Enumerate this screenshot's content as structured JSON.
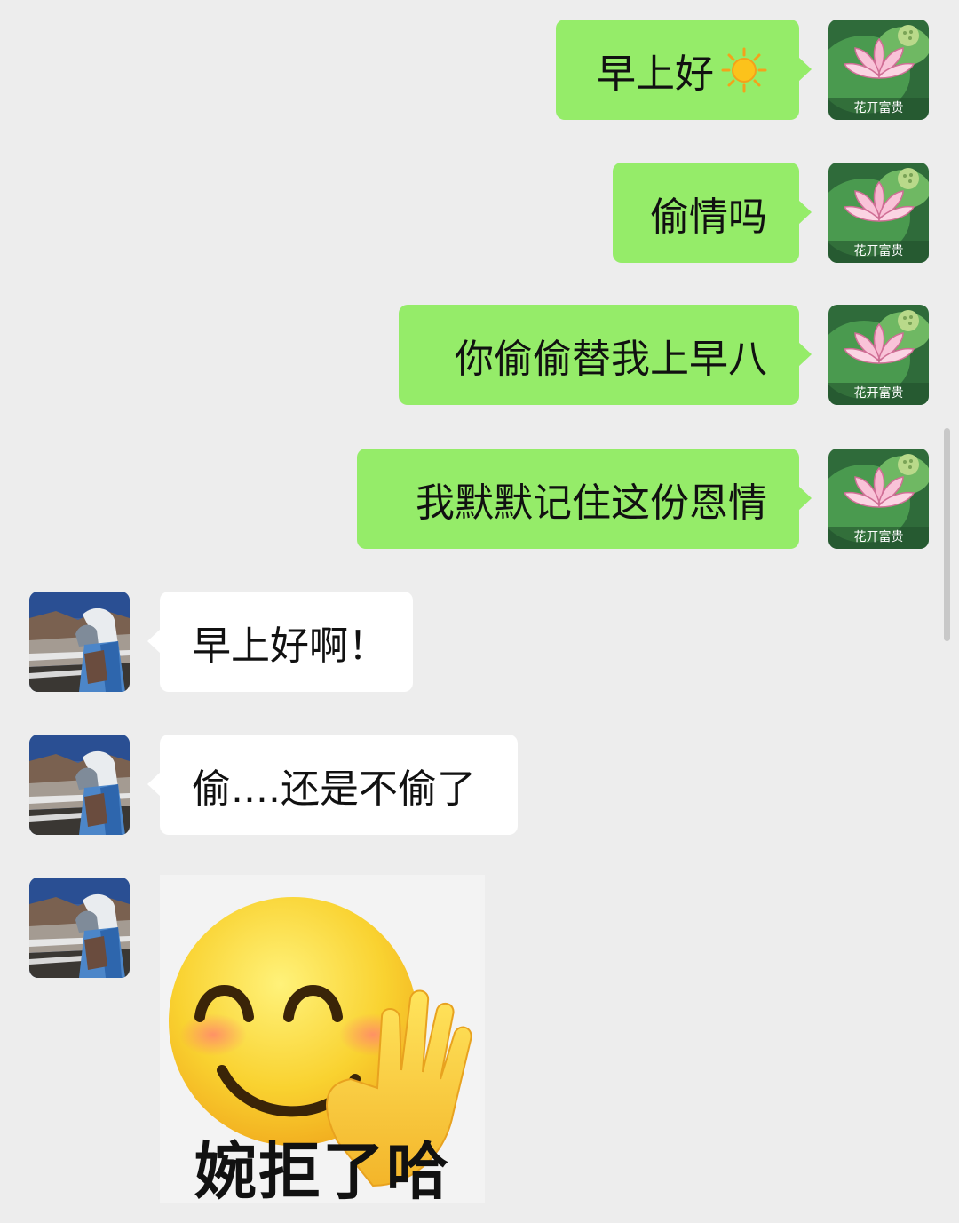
{
  "colors": {
    "background": "#ededed",
    "outgoing_bubble": "#95ec69",
    "incoming_bubble": "#ffffff",
    "text": "#111111"
  },
  "self_avatar": {
    "label": "花开富贵",
    "icon": "lotus-icon"
  },
  "contact_avatar": {
    "icon": "person-photo-avatar"
  },
  "messages": [
    {
      "direction": "out",
      "text": "早上好",
      "emoji": "sun-emoji"
    },
    {
      "direction": "out",
      "text": "偷情吗"
    },
    {
      "direction": "out",
      "text": "你偷偷替我上早八"
    },
    {
      "direction": "out",
      "text": "我默默记住这份恩情"
    },
    {
      "direction": "in",
      "text": "早上好啊！"
    },
    {
      "direction": "in",
      "text": "偷....还是不偷了"
    },
    {
      "direction": "in",
      "type": "sticker",
      "caption": "婉拒了哈",
      "icon": "waving-smile-emoji"
    }
  ]
}
